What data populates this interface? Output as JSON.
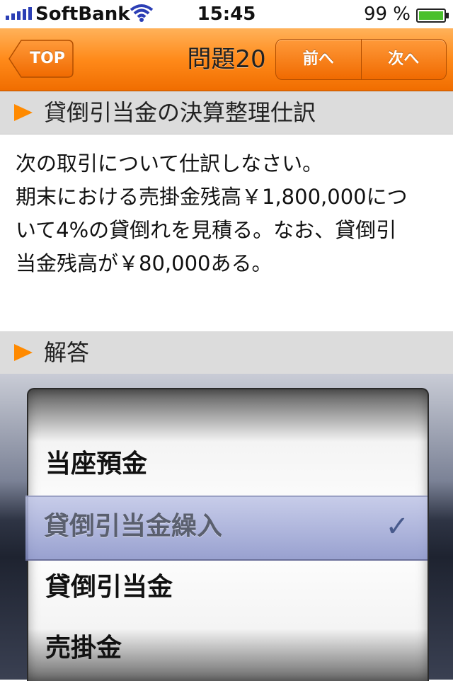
{
  "status_bar": {
    "carrier": "SoftBank",
    "time": "15:45",
    "battery": "99 %"
  },
  "navbar": {
    "back_label": "TOP",
    "title": "問題20",
    "prev_label": "前へ",
    "next_label": "次へ"
  },
  "question": {
    "header": "貸倒引当金の決算整理仕訳",
    "line1": "次の取引について仕訳しなさい。",
    "line2": "期末における売掛金残高￥1,800,000につ",
    "line3": "いて4%の貸倒れを見積る。なお、貸倒引",
    "line4": "当金残高が￥80,000ある。"
  },
  "answer": {
    "header": "解答"
  },
  "picker": {
    "options": [
      "当座預金",
      "貸倒引当金繰入",
      "貸倒引当金",
      "売掛金"
    ],
    "selected": "貸倒引当金繰入",
    "check": "✓"
  },
  "colors": {
    "accent": "#ff8a1a",
    "section_bg": "#dcdcdc"
  }
}
